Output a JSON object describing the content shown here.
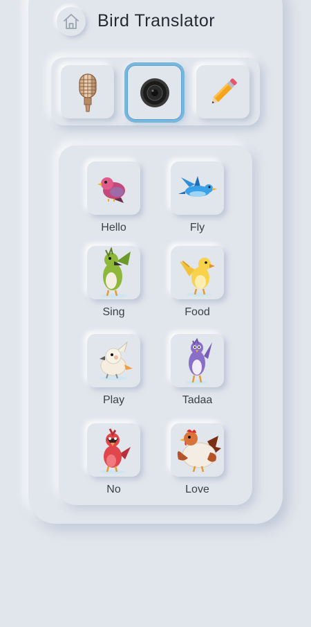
{
  "header": {
    "title": "Bird Translator",
    "home_icon": "home-icon"
  },
  "modes": [
    {
      "name": "microphone",
      "icon": "microphone-icon",
      "active": false
    },
    {
      "name": "speaker",
      "icon": "speaker-icon",
      "active": true
    },
    {
      "name": "pencil",
      "icon": "pencil-icon",
      "active": false
    }
  ],
  "birds": [
    {
      "label": "Hello",
      "icon": "pink-bird-icon",
      "color": "#c4487a"
    },
    {
      "label": "Fly",
      "icon": "blue-flying-bird-icon",
      "color": "#2f8fd6"
    },
    {
      "label": "Sing",
      "icon": "green-singing-bird-icon",
      "color": "#8db83a"
    },
    {
      "label": "Food",
      "icon": "yellow-bird-icon",
      "color": "#f2c23a"
    },
    {
      "label": "Play",
      "icon": "white-cockatoo-icon",
      "color": "#f4ede0"
    },
    {
      "label": "Tadaa",
      "icon": "purple-bird-icon",
      "color": "#8a6fc8"
    },
    {
      "label": "No",
      "icon": "red-cardinal-icon",
      "color": "#e0474c"
    },
    {
      "label": "Love",
      "icon": "hen-icon",
      "color": "#b5542a"
    }
  ],
  "colors": {
    "background": "#e1e5ec",
    "active_ring": "#7ab6dc",
    "text": "#222a33"
  }
}
